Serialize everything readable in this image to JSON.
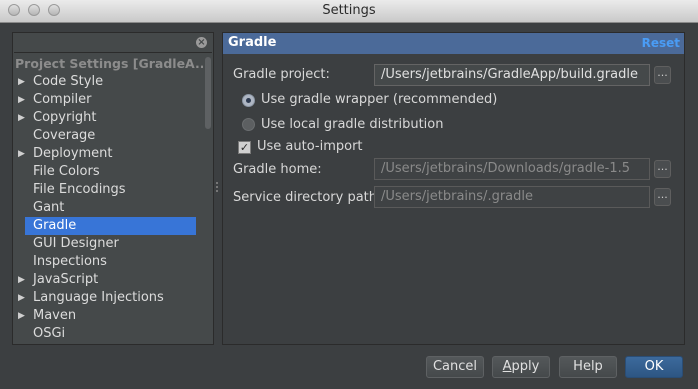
{
  "window": {
    "title": "Settings"
  },
  "search": {
    "value": "",
    "placeholder": ""
  },
  "tree": {
    "header": "Project Settings [GradleA...",
    "items": [
      {
        "label": "Code Style",
        "expandable": true
      },
      {
        "label": "Compiler",
        "expandable": true
      },
      {
        "label": "Copyright",
        "expandable": true
      },
      {
        "label": "Coverage",
        "expandable": false
      },
      {
        "label": "Deployment",
        "expandable": true
      },
      {
        "label": "File Colors",
        "expandable": false
      },
      {
        "label": "File Encodings",
        "expandable": false
      },
      {
        "label": "Gant",
        "expandable": false
      },
      {
        "label": "Gradle",
        "expandable": false,
        "selected": true
      },
      {
        "label": "GUI Designer",
        "expandable": false
      },
      {
        "label": "Inspections",
        "expandable": false
      },
      {
        "label": "JavaScript",
        "expandable": true
      },
      {
        "label": "Language Injections",
        "expandable": true
      },
      {
        "label": "Maven",
        "expandable": true
      },
      {
        "label": "OSGi",
        "expandable": false
      }
    ]
  },
  "gradle": {
    "title": "Gradle",
    "reset_label": "Reset",
    "project_label": "Gradle project:",
    "project_value": "/Users/jetbrains/GradleApp/build.gradle",
    "wrapper_label": "Use gradle wrapper (recommended)",
    "wrapper_selected": true,
    "local_label": "Use local gradle distribution",
    "local_selected": false,
    "auto_import_label": "Use auto-import",
    "auto_import_checked": true,
    "home_label": "Gradle home:",
    "home_value": "/Users/jetbrains/Downloads/gradle-1.5",
    "service_label": "Service directory path:",
    "service_value": "/Users/jetbrains/.gradle",
    "browse_glyph": "..."
  },
  "buttons": {
    "cancel": "Cancel",
    "apply_underlined": "A",
    "apply_rest": "pply",
    "help": "Help",
    "ok": "OK"
  },
  "colors": {
    "selection": "#3875d7",
    "header": "#4b6a99",
    "link": "#4a9cf5"
  }
}
